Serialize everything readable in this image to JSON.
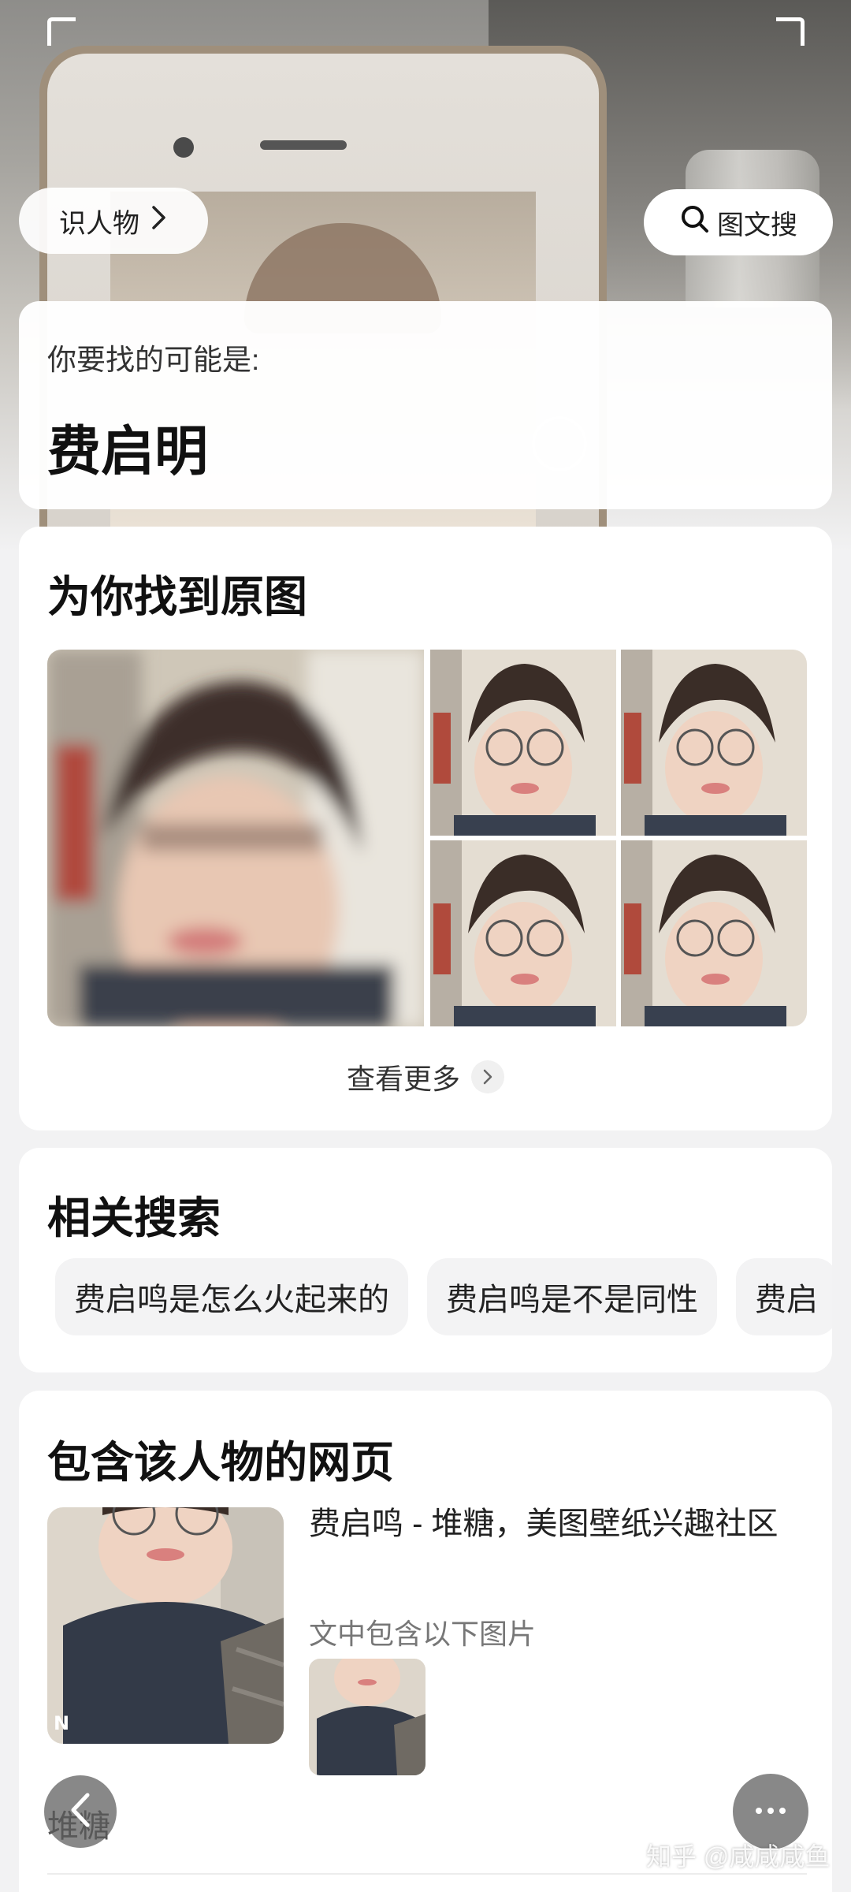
{
  "header": {
    "identify_label": "识人物",
    "search_label": "图文搜"
  },
  "result": {
    "subtitle": "你要找的可能是:",
    "name": "费启明"
  },
  "original": {
    "title": "为你找到原图",
    "more_label": "查看更多"
  },
  "related": {
    "title": "相关搜索",
    "chips": [
      "费启鸣是怎么火起来的",
      "费启鸣是不是同性",
      "费启"
    ]
  },
  "pages": {
    "title": "包含该人物的网页",
    "item_title": "费启鸣 - 堆糖，美图壁纸兴趣社区",
    "item_sub": "文中包含以下图片",
    "site": "堆糖"
  },
  "watermark": "知乎 @咸咸咸鱼",
  "icons": {
    "identify_chevron": "chevron-right-icon",
    "search": "search-icon",
    "more_chevron": "chevron-right-icon",
    "back": "chevron-left-icon",
    "more": "more-dots-icon"
  }
}
